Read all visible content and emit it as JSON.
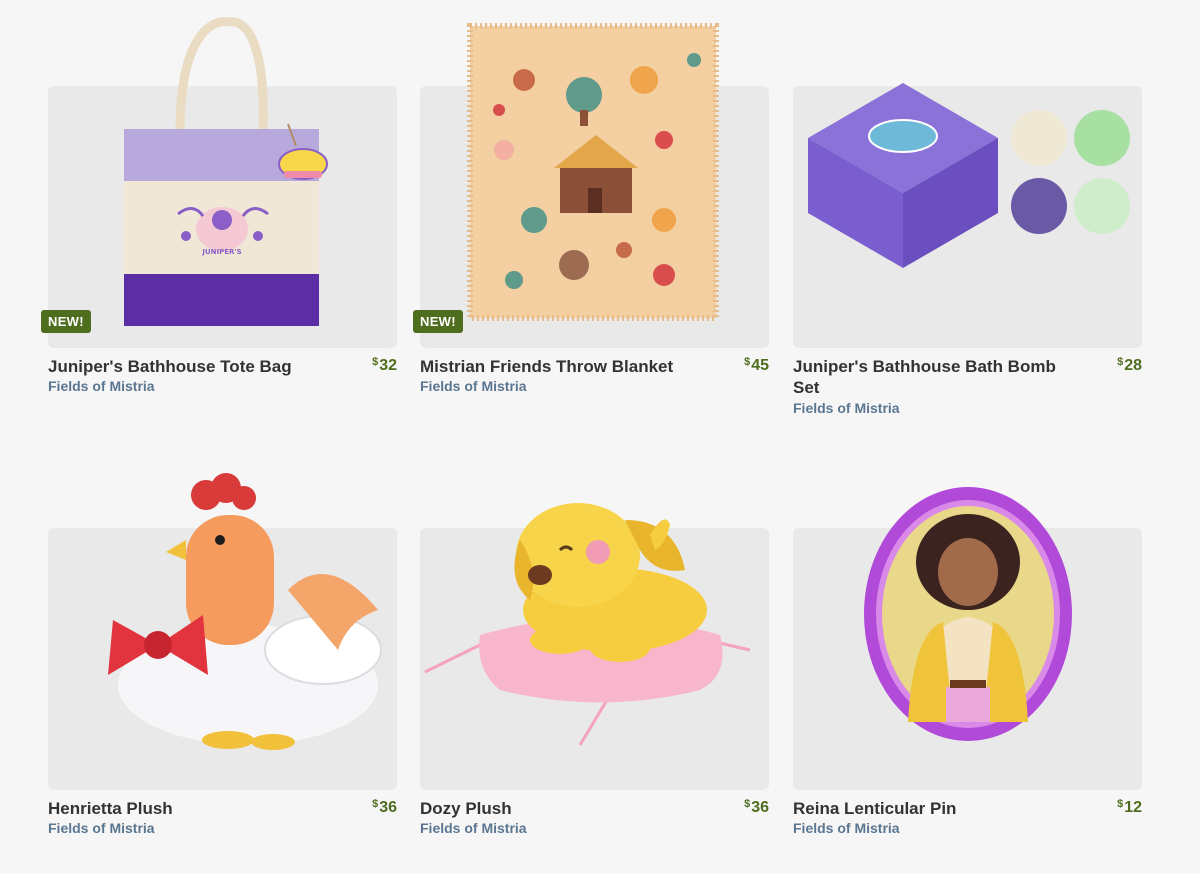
{
  "products": [
    {
      "title": "Juniper's Bathhouse Tote Bag",
      "subtitle": "Fields of Mistria",
      "currency": "$",
      "price": "32",
      "badge": "NEW!",
      "tag_text": "JUNIPER'S"
    },
    {
      "title": "Mistrian Friends Throw Blanket",
      "subtitle": "Fields of Mistria",
      "currency": "$",
      "price": "45",
      "badge": "NEW!"
    },
    {
      "title": "Juniper's Bathhouse Bath Bomb Set",
      "subtitle": "Fields of Mistria",
      "currency": "$",
      "price": "28"
    },
    {
      "title": "Henrietta Plush",
      "subtitle": "Fields of Mistria",
      "currency": "$",
      "price": "36"
    },
    {
      "title": "Dozy Plush",
      "subtitle": "Fields of Mistria",
      "currency": "$",
      "price": "36"
    },
    {
      "title": "Reina Lenticular Pin",
      "subtitle": "Fields of Mistria",
      "currency": "$",
      "price": "12"
    }
  ],
  "colors": {
    "badge": "#4f6d1f",
    "price": "#4f6d1f",
    "subtitle": "#5b7691",
    "title": "#333333",
    "background": "#f6f6f6",
    "card": "#e9e9e9"
  }
}
